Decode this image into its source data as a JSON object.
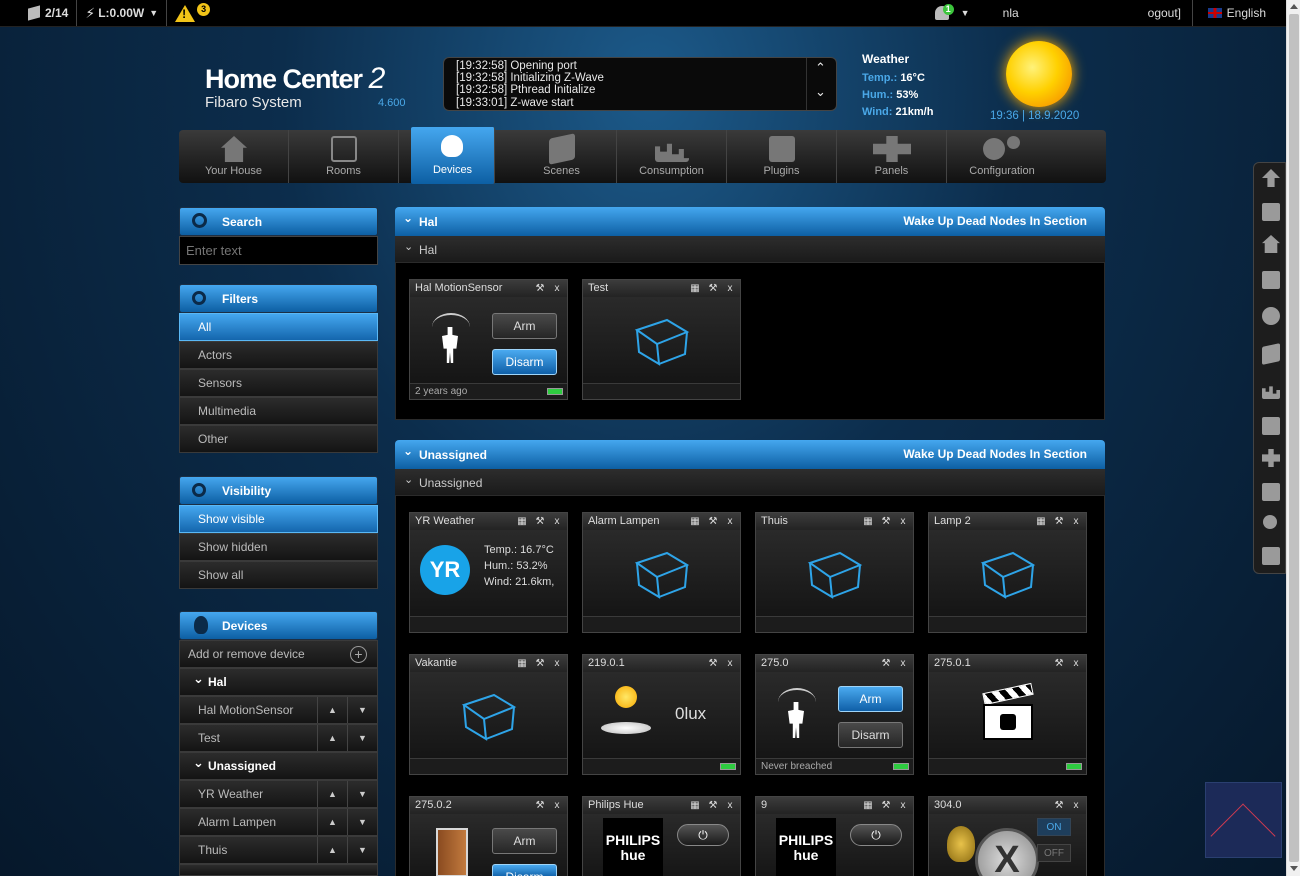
{
  "topbar": {
    "devices_count": "2/14",
    "power": "L:0.00W",
    "warnings": "3",
    "user_badge": "1",
    "user_name": "nla",
    "logout": "ogout]",
    "language": "English"
  },
  "header": {
    "logo_title": "Home Center",
    "logo_number": "2",
    "logo_subtitle": "Fibaro System",
    "version": "4.600",
    "log": [
      "[19:32:58] Opening port",
      "[19:32:58] Initializing Z-Wave",
      "[19:32:58] Pthread Initialize",
      "[19:33:01] Z-wave start"
    ]
  },
  "weather": {
    "title": "Weather",
    "temp_label": "Temp.:",
    "temp_value": "16°C",
    "hum_label": "Hum.:",
    "hum_value": "53%",
    "wind_label": "Wind:",
    "wind_value": "21km/h",
    "time_date": "19:36 | 18.9.2020"
  },
  "nav": [
    {
      "label": "Your House",
      "icon": "house-icon"
    },
    {
      "label": "Rooms",
      "icon": "rooms-icon"
    },
    {
      "label": "Devices",
      "icon": "bulb-icon",
      "active": true
    },
    {
      "label": "Scenes",
      "icon": "clapper-icon"
    },
    {
      "label": "Consumption",
      "icon": "chart-icon"
    },
    {
      "label": "Plugins",
      "icon": "plugin-icon"
    },
    {
      "label": "Panels",
      "icon": "puzzle-icon"
    },
    {
      "label": "Configuration",
      "icon": "gear-icon"
    }
  ],
  "sidebar": {
    "search_title": "Search",
    "search_placeholder": "Enter text",
    "filters_title": "Filters",
    "filters": [
      "All",
      "Actors",
      "Sensors",
      "Multimedia",
      "Other"
    ],
    "visibility_title": "Visibility",
    "visibility": [
      "Show visible",
      "Show hidden",
      "Show all"
    ],
    "devices_title": "Devices",
    "add_remove": "Add or remove device",
    "tree": [
      {
        "type": "group",
        "label": "Hal"
      },
      {
        "type": "item",
        "label": "Hal MotionSensor"
      },
      {
        "type": "item",
        "label": "Test"
      },
      {
        "type": "group",
        "label": "Unassigned"
      },
      {
        "type": "item",
        "label": "YR Weather"
      },
      {
        "type": "item",
        "label": "Alarm Lampen"
      },
      {
        "type": "item",
        "label": "Thuis"
      }
    ]
  },
  "sections": {
    "wake_label": "Wake Up Dead Nodes In Section",
    "hal": {
      "title": "Hal",
      "sub": "Hal",
      "cards": {
        "motion": {
          "title": "Hal MotionSensor",
          "arm": "Arm",
          "disarm": "Disarm",
          "foot": "2 years ago"
        },
        "test": {
          "title": "Test"
        }
      }
    },
    "unassigned": {
      "title": "Unassigned",
      "sub": "Unassigned",
      "cards": {
        "yr": {
          "title": "YR Weather",
          "logo": "YR",
          "temp": "Temp.: 16.7°C",
          "hum": "Hum.: 53.2%",
          "wind": "Wind: 21.6km,"
        },
        "alarm": {
          "title": "Alarm Lampen"
        },
        "thuis": {
          "title": "Thuis"
        },
        "lamp2": {
          "title": "Lamp 2"
        },
        "vakantie": {
          "title": "Vakantie"
        },
        "lux": {
          "title": "219.0.1",
          "value": "0lux"
        },
        "motion2": {
          "title": "275.0",
          "arm": "Arm",
          "disarm": "Disarm",
          "foot": "Never breached"
        },
        "scene": {
          "title": "275.0.1"
        },
        "door": {
          "title": "275.0.2",
          "arm": "Arm",
          "disarm": "Disarm"
        },
        "hue1": {
          "title": "Philips Hue",
          "brand1": "PHILIPS",
          "brand2": "hue"
        },
        "hue2": {
          "title": "9",
          "brand1": "PHILIPS",
          "brand2": "hue"
        },
        "switch": {
          "title": "304.0",
          "on": "ON",
          "off": "OFF"
        }
      }
    }
  },
  "colors": {
    "accent": "#1e88d8",
    "background": "#0c2d4c",
    "link": "#4aa8e8",
    "battery": "#2ecc40"
  }
}
